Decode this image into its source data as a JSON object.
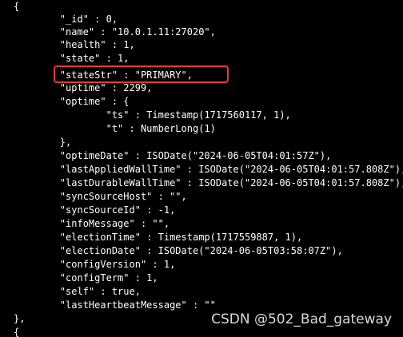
{
  "terminal": {
    "lines": [
      "{",
      "        \"_id\" : 0,",
      "        \"name\" : \"10.0.1.11:27020\",",
      "        \"health\" : 1,",
      "        \"state\" : 1,",
      "        \"stateStr\" : \"PRIMARY\",",
      "        \"uptime\" : 2299,",
      "        \"optime\" : {",
      "                \"ts\" : Timestamp(1717560117, 1),",
      "                \"t\" : NumberLong(1)",
      "        },",
      "        \"optimeDate\" : ISODate(\"2024-06-05T04:01:57Z\"),",
      "        \"lastAppliedWallTime\" : ISODate(\"2024-06-05T04:01:57.808Z\"),",
      "        \"lastDurableWallTime\" : ISODate(\"2024-06-05T04:01:57.808Z\"),",
      "        \"syncSourceHost\" : \"\",",
      "        \"syncSourceId\" : -1,",
      "        \"infoMessage\" : \"\",",
      "        \"electionTime\" : Timestamp(1717559887, 1),",
      "        \"electionDate\" : ISODate(\"2024-06-05T03:58:07Z\"),",
      "        \"configVersion\" : 1,",
      "        \"configTerm\" : 1,",
      "        \"self\" : true,",
      "        \"lastHeartbeatMessage\" : \"\"",
      "},",
      "{"
    ]
  },
  "watermark": "CSDN @502_Bad_gateway",
  "colors": {
    "background": "#000000",
    "text": "#ffffff",
    "highlight": "#e53935"
  }
}
